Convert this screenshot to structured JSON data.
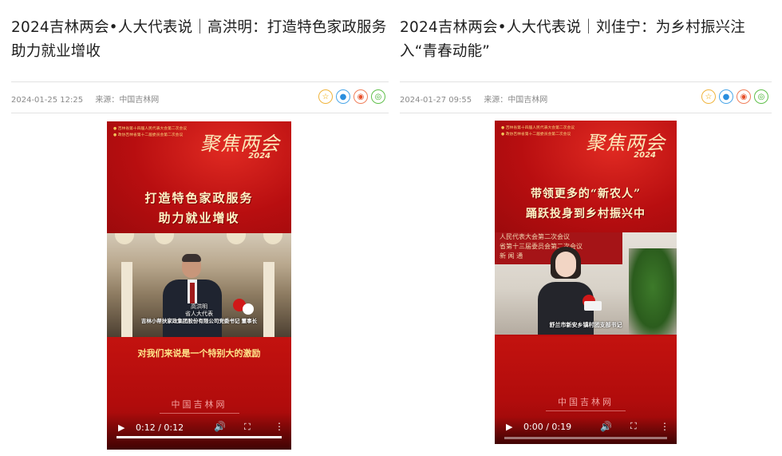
{
  "articles": [
    {
      "title": "2024吉林两会•人大代表说｜高洪明：打造特色家政服务助力就业增收",
      "date": "2024-01-25 12:25",
      "source_label": "来源：",
      "source": "中国吉林网",
      "video": {
        "emblem_lines": [
          "吉林省第十四届人民代表大会第二次会议",
          "政协吉林省第十二届委员会第二次会议"
        ],
        "brand": "聚焦两会",
        "year": "2024",
        "slogan_lines": [
          "打造特色家政服务",
          "助力就业增收"
        ],
        "caption_name": "高洪明",
        "caption_role": "省人大代表",
        "caption_org": "吉林小帮扶家政集团股份有限公司党委书记 董事长",
        "quote": "对我们来说是一个特别大的激励",
        "watermark": "中国吉林网",
        "time": "0:12 / 0:12",
        "progress": 1.0
      }
    },
    {
      "title": "2024吉林两会•人大代表说｜刘佳宁：为乡村振兴注入“青春动能”",
      "date": "2024-01-27 09:55",
      "source_label": "来源：",
      "source": "中国吉林网",
      "video": {
        "emblem_lines": [
          "吉林省第十四届人民代表大会第二次会议",
          "政协吉林省第十二届委员会第二次会议"
        ],
        "brand": "聚焦两会",
        "year": "2024",
        "slogan_lines": [
          "带领更多的“新农人”",
          "踊跃投身到乡村振兴中"
        ],
        "backdrop_lines": [
          "人民代表大会第二次会议",
          "省第十三届委员会第二次会议",
          "新 闻 通"
        ],
        "caption_org": "舒兰市新安乡镇村团支部书记",
        "watermark": "中国吉林网",
        "time": "0:00 / 0:19",
        "progress": 0.0
      }
    }
  ],
  "icons": {
    "star": "☆",
    "qq": "●",
    "weibo": "◉",
    "wechat": "◎",
    "play": "▶",
    "volume": "🔊",
    "fullscreen": "⛶",
    "more": "⋮"
  },
  "colors": {
    "video_red": "#b80d0d",
    "slogan": "#fff3c6",
    "quote": "#ffe58a"
  }
}
